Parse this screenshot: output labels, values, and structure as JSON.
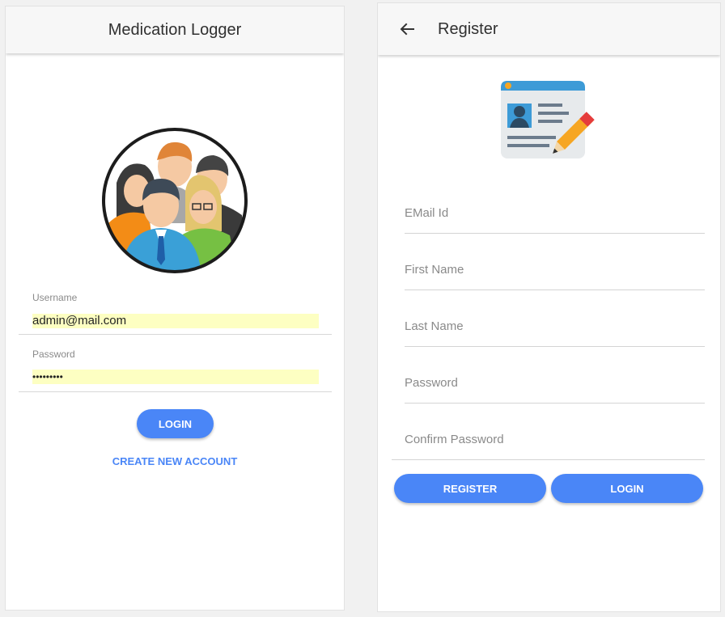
{
  "login_screen": {
    "title": "Medication Logger",
    "username_label": "Username",
    "username_value": "admin@mail.com",
    "password_label": "Password",
    "password_value": "•••••••••",
    "login_button": "LOGIN",
    "create_account_link": "CREATE NEW ACCOUNT"
  },
  "register_screen": {
    "title": "Register",
    "back_icon": "arrow-back-icon",
    "fields": {
      "email_placeholder": "EMail Id",
      "first_name_placeholder": "First Name",
      "last_name_placeholder": "Last Name",
      "password_placeholder": "Password",
      "confirm_password_placeholder": "Confirm Password"
    },
    "register_button": "REGISTER",
    "login_button": "LOGIN"
  },
  "colors": {
    "accent": "#4a86f7",
    "autofill": "#fdffc2"
  }
}
